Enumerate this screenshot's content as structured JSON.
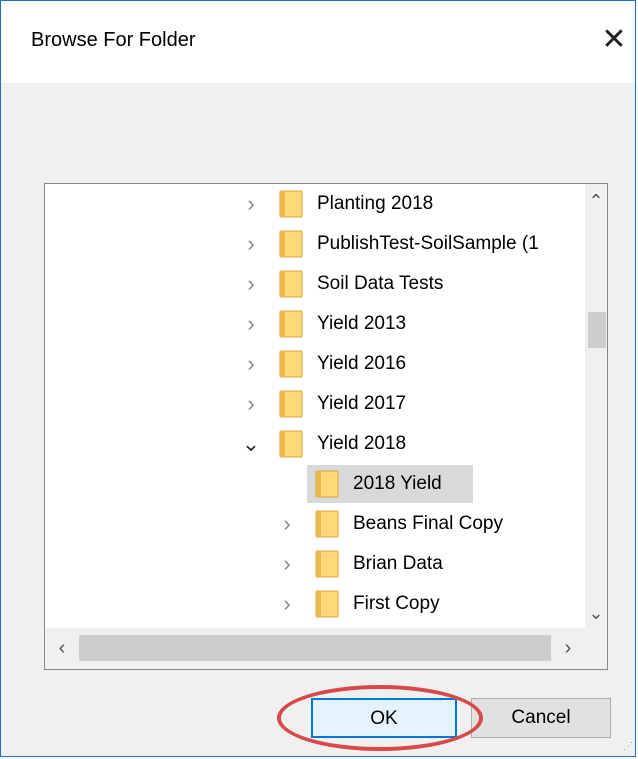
{
  "dialog": {
    "title": "Browse For Folder",
    "close_glyph": "✕"
  },
  "tree": {
    "items": [
      {
        "label": "Planting 2018",
        "state": "collapsed",
        "level": 0
      },
      {
        "label": "PublishTest-SoilSample (1",
        "state": "collapsed",
        "level": 0
      },
      {
        "label": "Soil Data Tests",
        "state": "collapsed",
        "level": 0
      },
      {
        "label": "Yield 2013",
        "state": "collapsed",
        "level": 0
      },
      {
        "label": "Yield 2016",
        "state": "collapsed",
        "level": 0
      },
      {
        "label": "Yield 2017",
        "state": "collapsed",
        "level": 0
      },
      {
        "label": "Yield 2018",
        "state": "expanded",
        "level": 0
      },
      {
        "label": "2018 Yield",
        "state": "leaf",
        "level": 1,
        "selected": true
      },
      {
        "label": "Beans Final Copy",
        "state": "collapsed",
        "level": 1
      },
      {
        "label": "Brian Data",
        "state": "collapsed",
        "level": 1
      },
      {
        "label": "First Copy",
        "state": "collapsed",
        "level": 1
      }
    ],
    "glyphs": {
      "collapsed": "›",
      "expanded": "⌄",
      "scroll_up": "⌃",
      "scroll_down": "⌄",
      "scroll_left": "‹",
      "scroll_right": "›"
    }
  },
  "buttons": {
    "ok": "OK",
    "cancel": "Cancel"
  },
  "colors": {
    "accent": "#0078d7",
    "highlight_ring": "#d84a4a",
    "folder_fill": "#ffd97a",
    "folder_tab": "#e8b84a"
  }
}
